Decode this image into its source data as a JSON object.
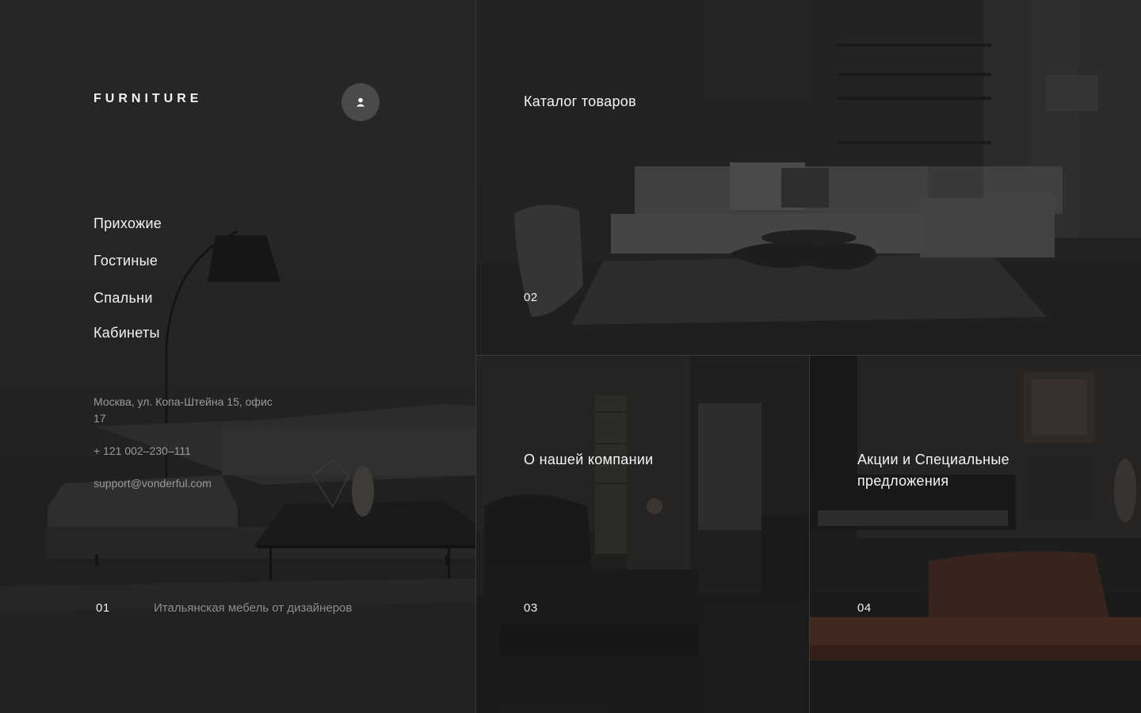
{
  "header": {
    "logo": "FURNITURE",
    "user_icon": "user-icon"
  },
  "nav": {
    "items": [
      {
        "label": "Прихожие"
      },
      {
        "label": "Гостиные"
      },
      {
        "label": "Спальни"
      },
      {
        "label": "Кабинеты"
      }
    ]
  },
  "contacts": {
    "address": "Москва, ул. Копа-Штейна 15, офис 17",
    "phone": "+ 121 002–230–111",
    "email": "support@vonderful.com"
  },
  "hero": {
    "number": "01",
    "tagline": "Итальянская мебель от дизайнеров"
  },
  "tiles": [
    {
      "number": "02",
      "title": "Каталог товаров"
    },
    {
      "number": "03",
      "title": "О нашей компании"
    },
    {
      "number": "04",
      "title": "Акции и Специальные предложения"
    }
  ],
  "colors": {
    "background": "#1c1c1c",
    "text": "#f2f2f2",
    "muted": "#9a9a9a",
    "user_button": "#4a4a4a",
    "accent_leather": "#5a3526"
  }
}
